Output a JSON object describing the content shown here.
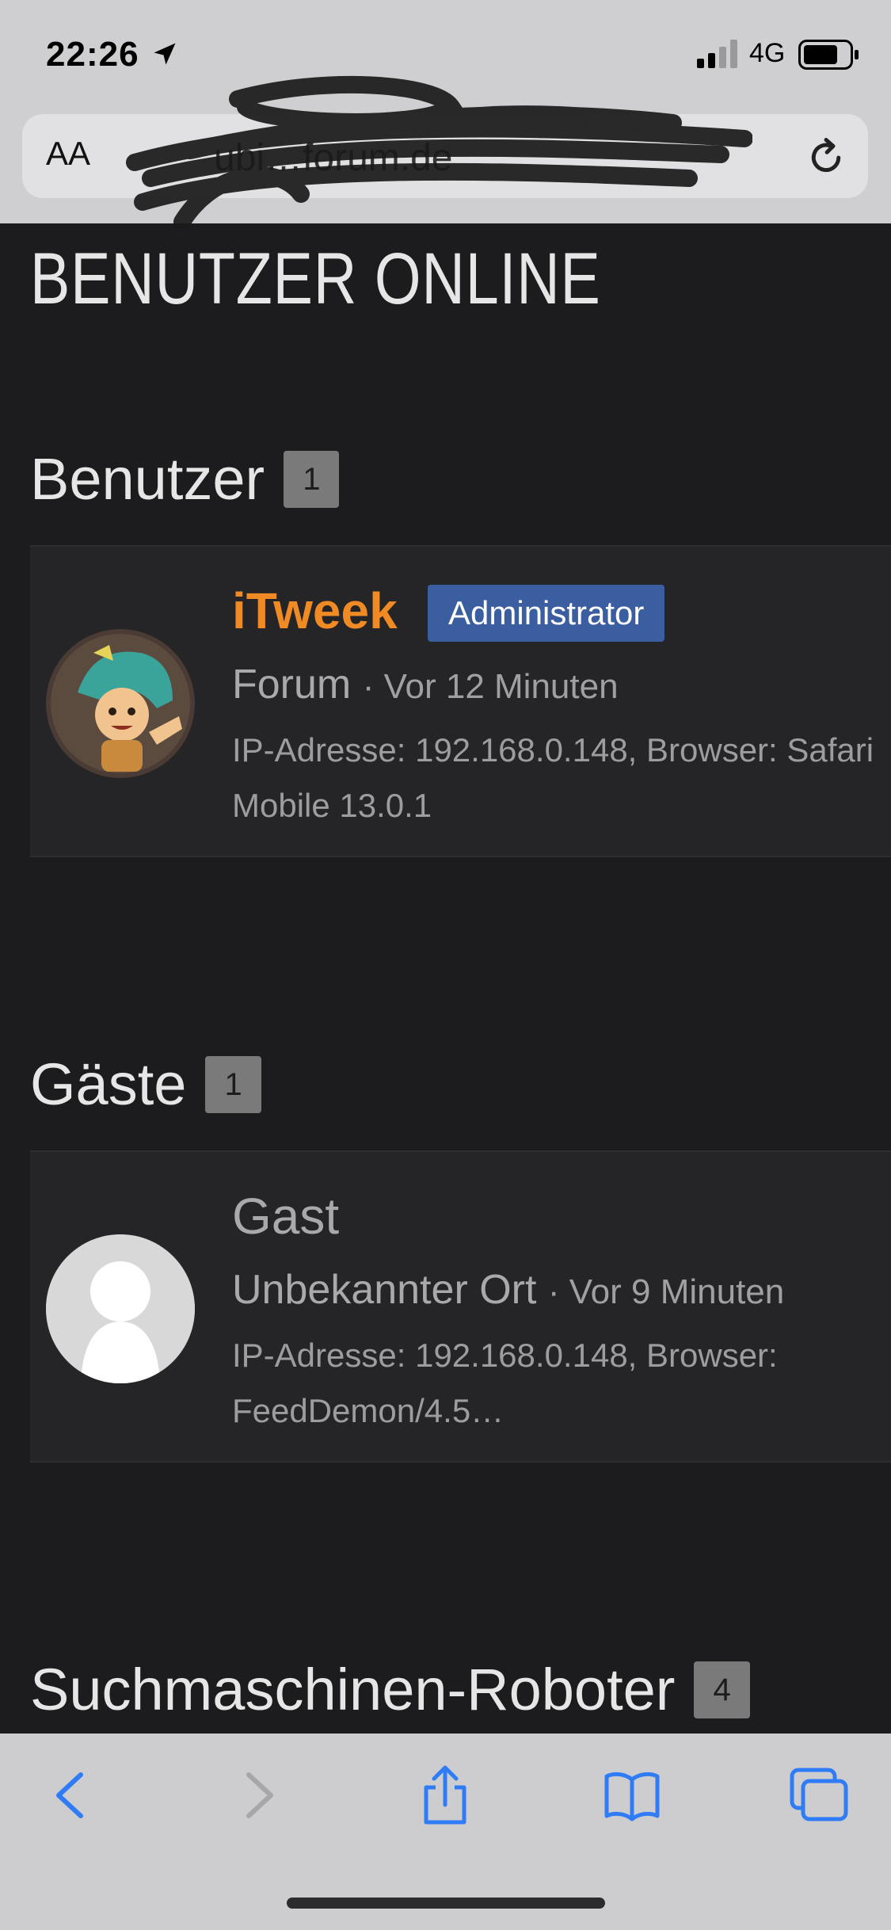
{
  "status_bar": {
    "time": "22:26",
    "network": "4G"
  },
  "address_bar": {
    "text_size_label": "AA",
    "url": "ubi…forum.de"
  },
  "page": {
    "heading": "BENUTZER ONLINE"
  },
  "users_section": {
    "title": "Benutzer",
    "count": "1",
    "user": {
      "name": "iTweek",
      "role": "Administrator",
      "location": "Forum",
      "time": "· Vor 12 Minuten",
      "details": "IP-Adresse: 192.168.0.148, Browser: Safari Mobile 13.0.1"
    }
  },
  "guests_section": {
    "title": "Gäste",
    "count": "1",
    "guest": {
      "name": "Gast",
      "location": "Unbekannter Ort",
      "time": "· Vor 9 Minuten",
      "details": "IP-Adresse: 192.168.0.148, Browser: FeedDemon/4.5…"
    }
  },
  "robots_section": {
    "title": "Suchmaschinen-Roboter",
    "count": "4"
  },
  "colors": {
    "username_accent": "#f08a24",
    "role_badge": "#3b5ea0",
    "ios_blue": "#2f7cf6",
    "background": "#1c1c1e"
  },
  "toolbar": {
    "icons": [
      "chevron-left-icon",
      "chevron-right-icon",
      "share-icon",
      "bookmarks-icon",
      "tabs-icon"
    ]
  }
}
